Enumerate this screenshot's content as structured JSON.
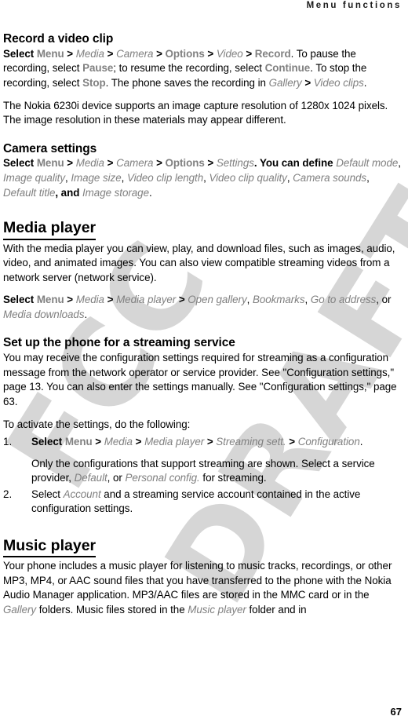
{
  "page": {
    "running_header": "Menu functions",
    "folio": "67",
    "watermark": {
      "line1": "FCC",
      "line2": "DRAFT",
      "color": "#d6d6d6"
    },
    "colors": {
      "text": "#000000",
      "ui_term": "#808080",
      "background": "#ffffff"
    }
  },
  "sections": [
    {
      "id": "record-a-video-clip",
      "type": "subhead",
      "heading": "Record a video clip",
      "paragraphs": [
        {
          "id": "record-video-path",
          "runs": [
            {
              "text": "Select ",
              "style": "bold"
            },
            {
              "text": "Menu",
              "style": "ui"
            },
            {
              "text": " > ",
              "style": "gt"
            },
            {
              "text": "Media",
              "style": "italic-gray"
            },
            {
              "text": " > ",
              "style": "gt"
            },
            {
              "text": "Camera",
              "style": "italic-gray"
            },
            {
              "text": " > ",
              "style": "gt"
            },
            {
              "text": "Options",
              "style": "ui"
            },
            {
              "text": " > ",
              "style": "gt"
            },
            {
              "text": "Video",
              "style": "italic-gray"
            },
            {
              "text": " > ",
              "style": "gt"
            },
            {
              "text": "Record",
              "style": "ui"
            },
            {
              "text": ". To pause the recording, select ",
              "style": "plain"
            },
            {
              "text": "Pause",
              "style": "ui"
            },
            {
              "text": "; to resume the recording, select ",
              "style": "plain"
            },
            {
              "text": "Continue",
              "style": "ui"
            },
            {
              "text": ". To stop the recording, select ",
              "style": "plain"
            },
            {
              "text": "Stop",
              "style": "ui"
            },
            {
              "text": ". The phone saves the recording in ",
              "style": "plain"
            },
            {
              "text": "Gallery",
              "style": "italic-gray"
            },
            {
              "text": " > ",
              "style": "gt"
            },
            {
              "text": "Video clips",
              "style": "italic-gray"
            },
            {
              "text": ".",
              "style": "plain"
            }
          ]
        },
        {
          "id": "resolution-note",
          "runs": [
            {
              "text": "The Nokia 6230i device supports an image capture resolution of 1280x 1024 pixels. The image resolution in these materials may appear different.",
              "style": "plain"
            }
          ]
        }
      ]
    },
    {
      "id": "camera-settings",
      "type": "subhead",
      "heading": "Camera settings",
      "paragraphs": [
        {
          "id": "camera-settings-path",
          "runs": [
            {
              "text": "Select ",
              "style": "bold"
            },
            {
              "text": "Menu",
              "style": "ui"
            },
            {
              "text": " > ",
              "style": "gt"
            },
            {
              "text": "Media",
              "style": "italic-gray"
            },
            {
              "text": " > ",
              "style": "gt"
            },
            {
              "text": "Camera",
              "style": "italic-gray"
            },
            {
              "text": " > ",
              "style": "gt"
            },
            {
              "text": "Options",
              "style": "ui"
            },
            {
              "text": " > ",
              "style": "gt"
            },
            {
              "text": "Settings",
              "style": "italic-gray"
            },
            {
              "text": ". You can define ",
              "style": "bold"
            },
            {
              "text": " Default mode",
              "style": "italic-gray"
            },
            {
              "text": ", ",
              "style": "plain"
            },
            {
              "text": "Image quality",
              "style": "italic-gray"
            },
            {
              "text": ", ",
              "style": "plain"
            },
            {
              "text": "Image size",
              "style": "italic-gray"
            },
            {
              "text": ", ",
              "style": "plain"
            },
            {
              "text": "Video clip length",
              "style": "italic-gray"
            },
            {
              "text": ", ",
              "style": "plain"
            },
            {
              "text": "Video clip quality",
              "style": "italic-gray"
            },
            {
              "text": ", ",
              "style": "plain"
            },
            {
              "text": "Camera sounds",
              "style": "italic-gray"
            },
            {
              "text": ", ",
              "style": "plain"
            },
            {
              "text": "Default title",
              "style": "italic-gray"
            },
            {
              "text": ", and ",
              "style": "bold"
            },
            {
              "text": "Image storage",
              "style": "italic-gray"
            },
            {
              "text": ".",
              "style": "plain"
            }
          ]
        }
      ]
    },
    {
      "id": "media-player",
      "type": "section",
      "heading": "Media player",
      "paragraphs": [
        {
          "id": "media-player-intro",
          "runs": [
            {
              "text": "With the media player you can view, play, and download files, such as images, audio, video, and animated images. You can also view compatible streaming videos from a network server (network service).",
              "style": "plain"
            }
          ]
        },
        {
          "id": "media-player-path",
          "runs": [
            {
              "text": "Select ",
              "style": "bold"
            },
            {
              "text": "Menu",
              "style": "ui"
            },
            {
              "text": " > ",
              "style": "gt"
            },
            {
              "text": "Media",
              "style": "italic-gray"
            },
            {
              "text": " > ",
              "style": "gt"
            },
            {
              "text": "Media player",
              "style": "italic-gray"
            },
            {
              "text": " > ",
              "style": "gt"
            },
            {
              "text": "Open gallery",
              "style": "italic-gray"
            },
            {
              "text": ", ",
              "style": "plain"
            },
            {
              "text": "Bookmarks",
              "style": "italic-gray"
            },
            {
              "text": ", ",
              "style": "plain"
            },
            {
              "text": "Go to address",
              "style": "italic-gray"
            },
            {
              "text": ", or ",
              "style": "plain"
            },
            {
              "text": "Media downloads",
              "style": "italic-gray"
            },
            {
              "text": ".",
              "style": "plain"
            }
          ]
        }
      ]
    },
    {
      "id": "set-up-streaming",
      "type": "subhead",
      "heading": "Set up the phone for a streaming service",
      "paragraphs": [
        {
          "id": "streaming-config-note",
          "runs": [
            {
              "text": "You may receive the configuration settings required for streaming as a configuration message from the network operator or service provider. See \"Configuration settings,\" page 13. You can also enter the settings manually. See \"Configuration settings,\" page 63.",
              "style": "plain"
            }
          ]
        },
        {
          "id": "streaming-activate-lead",
          "runs": [
            {
              "text": "To activate the settings, do the following:",
              "style": "plain"
            }
          ]
        }
      ],
      "steps": [
        {
          "number": "1.",
          "runs": [
            {
              "text": "Select ",
              "style": "bold"
            },
            {
              "text": "Menu",
              "style": "ui"
            },
            {
              "text": " > ",
              "style": "gt"
            },
            {
              "text": "Media",
              "style": "italic-gray"
            },
            {
              "text": " > ",
              "style": "gt"
            },
            {
              "text": "Media player",
              "style": "italic-gray"
            },
            {
              "text": " > ",
              "style": "gt"
            },
            {
              "text": "Streaming sett.",
              "style": "italic-gray"
            },
            {
              "text": " > ",
              "style": "gt"
            },
            {
              "text": "Configuration",
              "style": "italic-gray"
            },
            {
              "text": ".",
              "style": "plain"
            }
          ],
          "continuation": [
            {
              "text": "Only the configurations that support streaming are shown. Select a service provider, ",
              "style": "plain"
            },
            {
              "text": "Default",
              "style": "italic-gray"
            },
            {
              "text": ", or ",
              "style": "plain"
            },
            {
              "text": "Personal config.",
              "style": "italic-gray"
            },
            {
              "text": " for streaming.",
              "style": "plain"
            }
          ]
        },
        {
          "number": "2.",
          "runs": [
            {
              "text": "Select ",
              "style": "plain"
            },
            {
              "text": "Account",
              "style": "italic-gray"
            },
            {
              "text": " and a streaming service account contained in the active configuration settings.",
              "style": "plain"
            }
          ],
          "continuation": null
        }
      ]
    },
    {
      "id": "music-player",
      "type": "section",
      "heading": "Music player",
      "paragraphs": [
        {
          "id": "music-player-intro",
          "runs": [
            {
              "text": "Your phone includes a music player for listening to music tracks, recordings, or other MP3, MP4, or AAC sound files that you have transferred to the phone with the Nokia Audio Manager application. MP3/AAC files are stored in the MMC card or in the ",
              "style": "plain"
            },
            {
              "text": "Gallery",
              "style": "italic-gray"
            },
            {
              "text": " folders. Music files stored in the ",
              "style": "plain"
            },
            {
              "text": "Music player",
              "style": "italic-gray"
            },
            {
              "text": " folder and in",
              "style": "plain"
            }
          ]
        }
      ]
    }
  ]
}
